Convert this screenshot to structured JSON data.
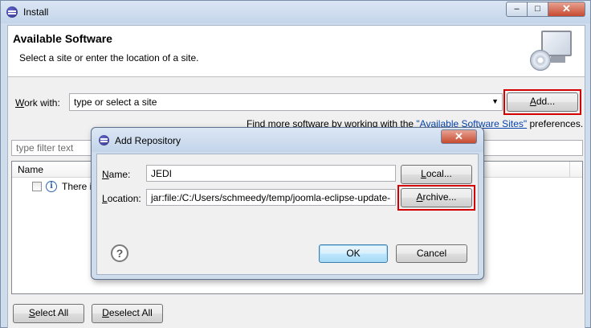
{
  "window": {
    "title": "Install",
    "minimize": "–",
    "maximize": "□",
    "close": "✕"
  },
  "header": {
    "title": "Available Software",
    "subtitle": "Select a site or enter the location of a site.",
    "icon": "cd-install-icon"
  },
  "work_with": {
    "label_prefix": "",
    "label_accel": "W",
    "label_rest": "ork with:",
    "value": "type or select a site",
    "add_accel": "A",
    "add_rest": "dd..."
  },
  "find_more": {
    "prefix": "Find more software by working with the ",
    "link": "\"Available Software Sites\"",
    "suffix": " preferences."
  },
  "filter": {
    "placeholder": "type filter text"
  },
  "table": {
    "header_name": "Name",
    "rows": [
      {
        "text": "There i",
        "checked": false,
        "icon": "info-icon"
      }
    ]
  },
  "bottom": {
    "select_all_accel": "S",
    "select_all_rest": "elect All",
    "deselect_all_accel": "D",
    "deselect_all_rest": "eselect All"
  },
  "dialog": {
    "title": "Add Repository",
    "close": "✕",
    "name_accel": "N",
    "name_rest": "ame:",
    "name_value": "JEDI",
    "local_accel": "L",
    "local_rest": "ocal...",
    "location_accel": "L",
    "location_rest": "ocation:",
    "location_value": "jar:file:/C:/Users/schmeedy/temp/joomla-eclipse-update-",
    "archive_accel": "A",
    "archive_rest": "rchive...",
    "help": "?",
    "ok": "OK",
    "cancel": "Cancel"
  },
  "colors": {
    "highlight": "#d40000",
    "link": "#0645ad"
  }
}
